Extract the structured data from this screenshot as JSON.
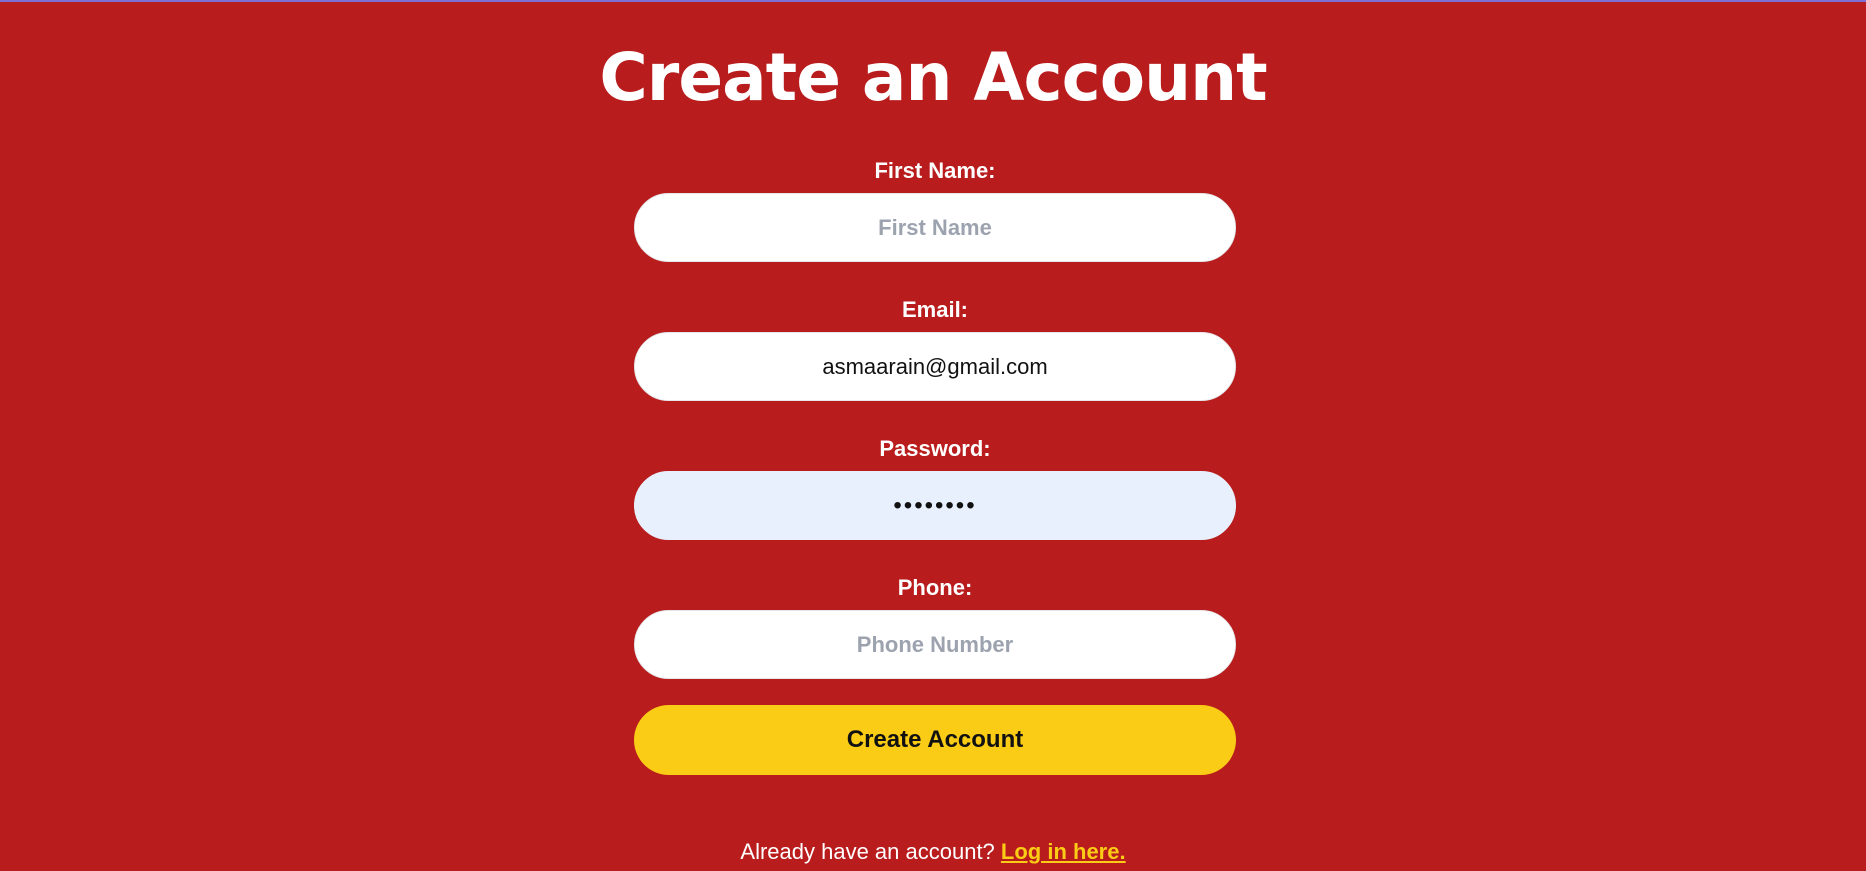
{
  "page": {
    "title": "Create an Account"
  },
  "form": {
    "first_name": {
      "label": "First Name:",
      "value": "",
      "placeholder": "First Name"
    },
    "email": {
      "label": "Email:",
      "value": "asmaarain@gmail.com",
      "placeholder": ""
    },
    "password": {
      "label": "Password:",
      "value": "••••••••",
      "placeholder": ""
    },
    "phone": {
      "label": "Phone:",
      "value": "",
      "placeholder": "Phone Number"
    },
    "submit_label": "Create Account"
  },
  "footer": {
    "prompt": "Already have an account?",
    "link_label": "Log in here."
  },
  "colors": {
    "background": "#b91c1c",
    "accent": "#facc15",
    "autofill_bg": "#e8f0fd",
    "top_strip": "#7c6fd6"
  }
}
